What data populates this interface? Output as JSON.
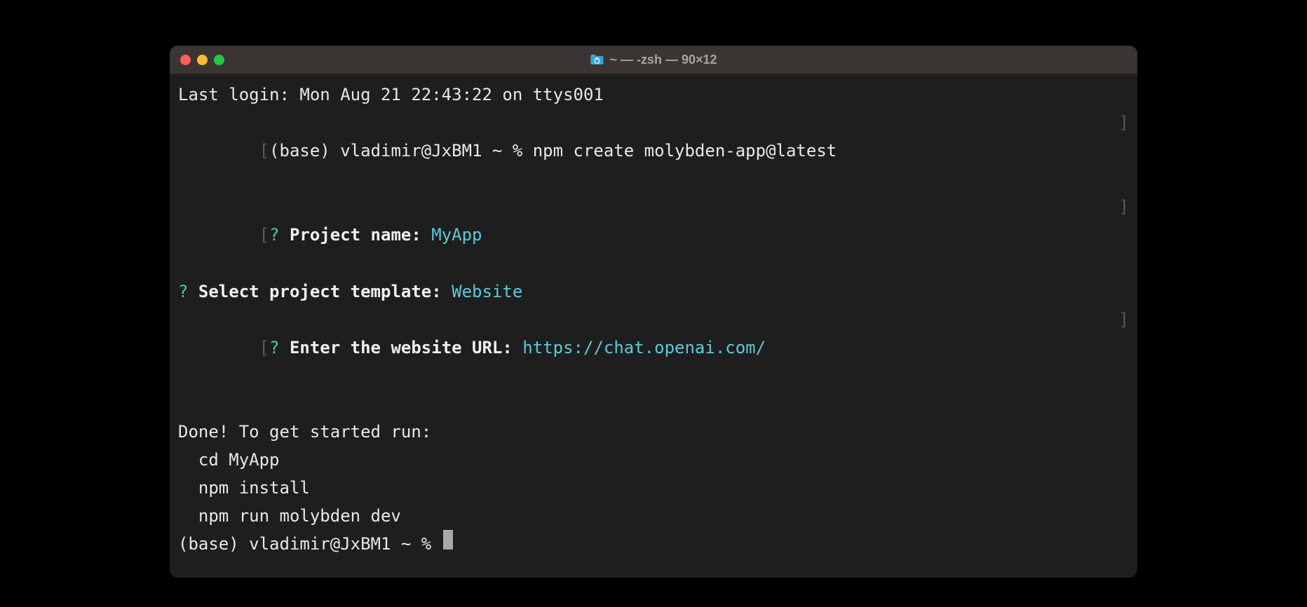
{
  "window": {
    "title": "~ — -zsh — 90×12"
  },
  "terminal": {
    "last_login": "Last login: Mon Aug 21 22:43:22 on ttys001",
    "prompt1_prefix": "(base) vladimir@JxBM1 ~ % ",
    "command1": "npm create molybden-app@latest",
    "bracket_open": "[",
    "bracket_close": "]",
    "q_mark": "?",
    "project_name_label": " Project name:",
    "project_name_value": " MyApp",
    "template_label": " Select project template:",
    "template_value": " Website",
    "url_label": " Enter the website URL:",
    "url_value": " https://chat.openai.com/",
    "empty": " ",
    "done_line": "Done! To get started run:",
    "step1": "  cd MyApp",
    "step2": "  npm install",
    "step3": "  npm run molybden dev",
    "prompt2": "(base) vladimir@JxBM1 ~ % "
  }
}
